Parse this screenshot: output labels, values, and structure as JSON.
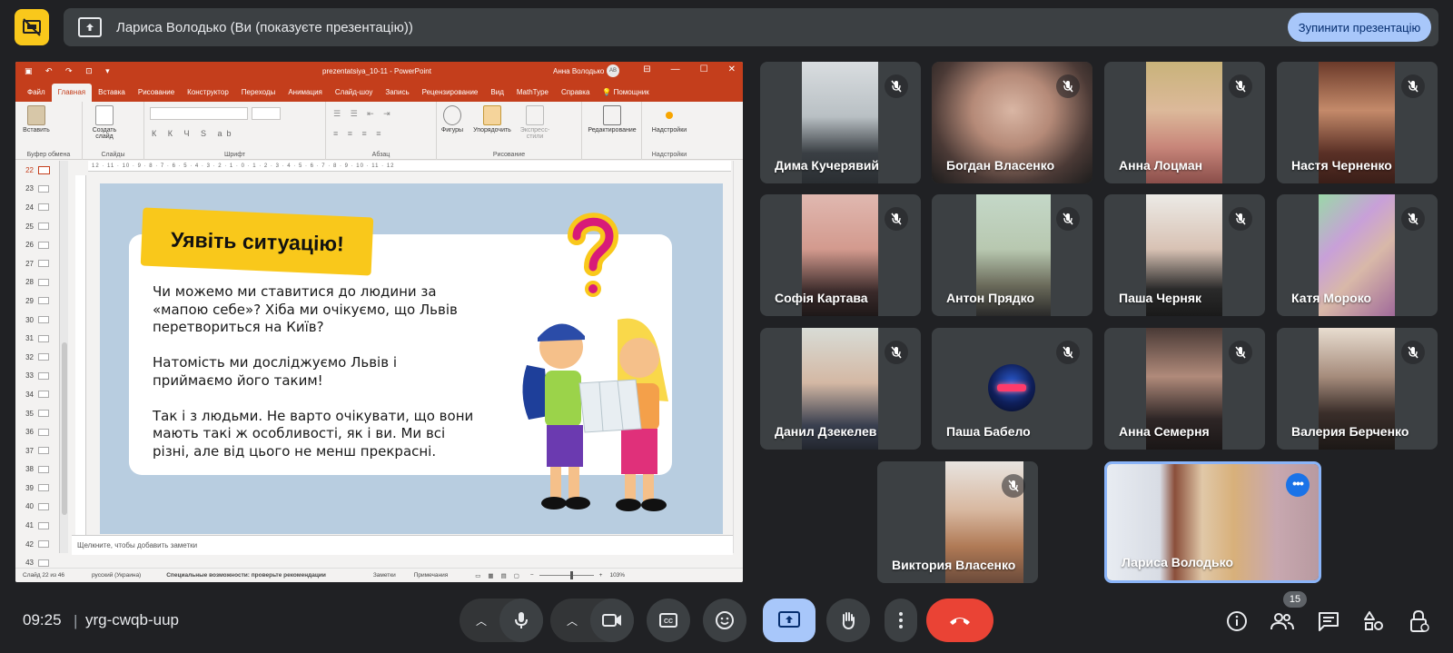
{
  "topbar": {
    "presenter_title": "Лариса Володько (Ви (показуєте презентацію))",
    "stop_button": "Зупинити презентацію"
  },
  "ppt": {
    "filename": "prezentatsiya_10-11 - PowerPoint",
    "username": "Анна Володько",
    "avatar_initials": "АВ",
    "tabs": [
      "Файл",
      "Главная",
      "Вставка",
      "Рисование",
      "Конструктор",
      "Переходы",
      "Анимация",
      "Слайд-шоу",
      "Запись",
      "Рецензирование",
      "Вид",
      "MathType",
      "Справка",
      "Помощник"
    ],
    "active_tab": "Главная",
    "ribbon": {
      "paste": "Вставить",
      "clipboard": "Буфер обмена",
      "new_slide": "Создать слайд",
      "slides": "Слайды",
      "font": "Шрифт",
      "paragraph": "Абзац",
      "shapes": "Фигуры",
      "arrange": "Упорядочить",
      "express": "Экспресс-стили",
      "drawing": "Рисование",
      "editing": "Редактирование",
      "addins_btn": "Надстройки",
      "addins": "Надстройки"
    },
    "ruler": "12 · 11 · 10 · 9 · 8 · 7 · 6 · 5 · 4 · 3 · 2 · 1 · 0 · 1 · 2 · 3 · 4 · 5 · 6 · 7 · 8 · 9 · 10 · 11 · 12",
    "thumbnails": [
      "22",
      "23",
      "24",
      "25",
      "26",
      "27",
      "28",
      "29",
      "30",
      "31",
      "32",
      "33",
      "34",
      "35",
      "36",
      "37",
      "38",
      "39",
      "40",
      "41",
      "42",
      "43"
    ],
    "active_slide": "22",
    "slide": {
      "heading": "Уявіть ситуацію!",
      "para1": "Чи можемо ми ставитися до людини за «мапою себе»? Хіба ми очікуємо, що Львів перетвориться на Київ?",
      "para2": "Натомість ми досліджуємо Львів і приймаємо його таким!",
      "para3": "Так і з людьми. Не варто очікувати, що вони мають такі ж особливості, як і ви. Ми всі різні, але від цього не менш прекрасні."
    },
    "notes_placeholder": "Щелкните, чтобы добавить заметки",
    "status": {
      "slide_count": "Слайд 22 из 46",
      "language": "русский (Украина)",
      "accessibility": "Специальные возможности: проверьте рекомендации",
      "notes": "Заметки",
      "comments": "Примечания",
      "zoom": "103%"
    }
  },
  "participants": [
    {
      "name": "Дима Кучерявий",
      "muted": true
    },
    {
      "name": "Богдан Власенко",
      "muted": true
    },
    {
      "name": "Анна Лоцман",
      "muted": true
    },
    {
      "name": "Настя Черненко",
      "muted": true
    },
    {
      "name": "Софія Картава",
      "muted": true
    },
    {
      "name": "Антон Прядко",
      "muted": true
    },
    {
      "name": "Паша Черняк",
      "muted": true
    },
    {
      "name": "Катя Мороко",
      "muted": true
    },
    {
      "name": "Данил Дзекелев",
      "muted": true
    },
    {
      "name": "Паша Бабело",
      "muted": true
    },
    {
      "name": "Анна Семерня",
      "muted": true
    },
    {
      "name": "Валерия Берченко",
      "muted": true
    },
    {
      "name": "Виктория Власенко",
      "muted": true
    },
    {
      "name": "Лариса Володько",
      "muted": false
    }
  ],
  "bottombar": {
    "time": "09:25",
    "separator": "|",
    "meeting_code": "yrg-cwqb-uup",
    "participant_count": "15"
  },
  "colors": {
    "accent": "#a8c7fa",
    "ppt_brand": "#c43e1c",
    "end_call": "#ea4335",
    "logo_yellow": "#f9c81b"
  }
}
